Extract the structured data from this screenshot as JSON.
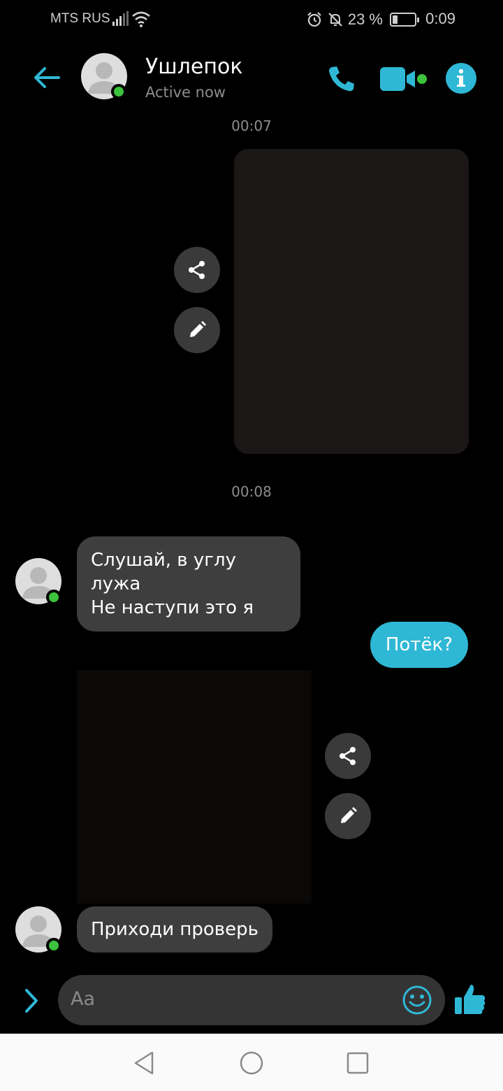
{
  "status_bar": {
    "carrier": "MTS RUS",
    "battery_percent": "23 %",
    "battery_level": 0.23,
    "time": "0:09",
    "icons": [
      "signal-icon",
      "wifi-icon",
      "alarm-icon",
      "mute-bell-icon",
      "battery-icon"
    ]
  },
  "header": {
    "name": "Ушлепок",
    "status": "Active now",
    "icons": [
      "back-arrow-icon",
      "phone-icon",
      "video-camera-icon",
      "info-icon"
    ]
  },
  "messages": {
    "timestamp_1": "00:07",
    "timestamp_2": "00:08",
    "incoming_1": "Слушай, в углу лужа\nНе наступи это я",
    "outgoing_1": "Потёк?",
    "incoming_2": "Приходи проверь",
    "photo_actions": [
      "share-icon",
      "edit-icon"
    ]
  },
  "composer": {
    "placeholder": "Aa",
    "icons": [
      "chevron-right-icon",
      "smiley-icon",
      "thumbs-up-icon"
    ]
  },
  "navigation": {
    "icons": [
      "back-triangle-icon",
      "home-circle-icon",
      "recents-square-icon"
    ]
  },
  "colors": {
    "accent": "#2fb8d6",
    "background": "#000000",
    "bubble_incoming": "#3e3e3e",
    "online_dot": "#3cc23c",
    "secondary_text": "#8d8d8d",
    "nav_bar": "#fafafa"
  }
}
